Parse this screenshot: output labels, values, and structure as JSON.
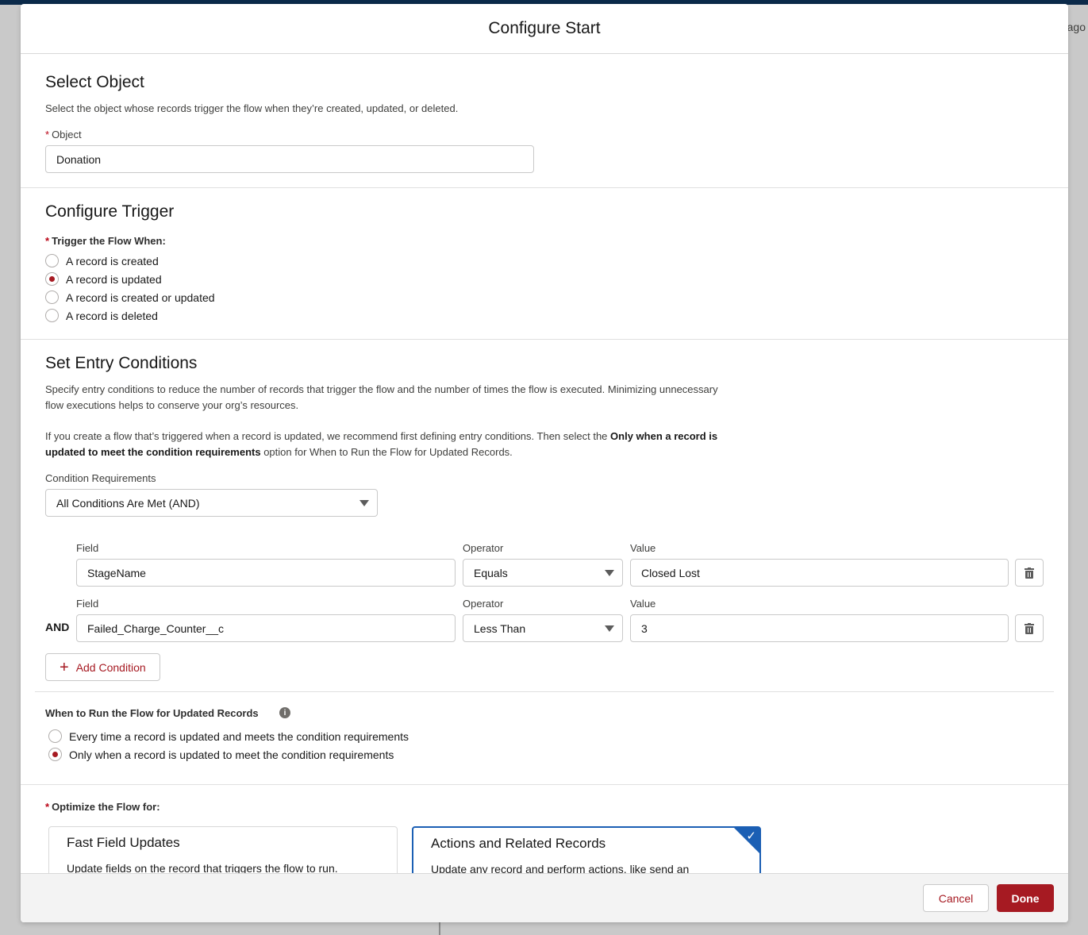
{
  "background": {
    "right_text": "ago"
  },
  "modal": {
    "title": "Configure Start"
  },
  "select_object": {
    "title": "Select Object",
    "help": "Select the object whose records trigger the flow when they’re created, updated, or deleted.",
    "object_label": "Object",
    "required_marker": "*",
    "object_value": "Donation"
  },
  "configure_trigger": {
    "title": "Configure Trigger",
    "label": "Trigger the Flow When:",
    "required_marker": "*",
    "options": [
      {
        "label": "A record is created",
        "selected": false
      },
      {
        "label": "A record is updated",
        "selected": true
      },
      {
        "label": "A record is created or updated",
        "selected": false
      },
      {
        "label": "A record is deleted",
        "selected": false
      }
    ]
  },
  "entry_conditions": {
    "title": "Set Entry Conditions",
    "help1_line1": "Specify entry conditions to reduce the number of records that trigger the flow and the number of times the flow is executed. Minimizing unnecessary",
    "help1_line2": "flow executions helps to conserve your org’s resources.",
    "help2_pre": "If you create a flow that’s triggered when a record is updated, we recommend first defining entry conditions. Then select the ",
    "help2_bold1": "Only when a record is",
    "help2_bold2": "updated to meet the condition requirements",
    "help2_post": " option for When to Run the Flow for Updated Records.",
    "requirements_label": "Condition Requirements",
    "requirements_value": "All Conditions Are Met (AND)",
    "conditions": [
      {
        "connector": "",
        "field_label": "Field",
        "field": "StageName",
        "operator_label": "Operator",
        "operator": "Equals",
        "value_label": "Value",
        "value": "Closed Lost"
      },
      {
        "connector": "AND",
        "field_label": "Field",
        "field": "Failed_Charge_Counter__c",
        "operator_label": "Operator",
        "operator": "Less Than",
        "value_label": "Value",
        "value": "3"
      }
    ],
    "add_condition": "Add Condition",
    "add_icon": "plus-icon",
    "delete_icon": "trash-icon"
  },
  "when_to_run": {
    "label": "When to Run the Flow for Updated Records",
    "info_icon": "info-icon",
    "info_glyph": "i",
    "options": [
      {
        "label": "Every time a record is updated and meets the condition requirements",
        "selected": false
      },
      {
        "label": "Only when a record is updated to meet the condition requirements",
        "selected": true
      }
    ]
  },
  "optimize": {
    "label": "Optimize the Flow for:",
    "required_marker": "*",
    "cards": [
      {
        "title": "Fast Field Updates",
        "desc": "Update fields on the record that triggers the flow to run.",
        "selected": false
      },
      {
        "title": "Actions and Related Records",
        "desc": "Update any record and perform actions, like send an",
        "selected": true
      }
    ],
    "check_glyph": "✓"
  },
  "footer": {
    "cancel": "Cancel",
    "done": "Done"
  },
  "colors": {
    "brand_red": "#a61a22",
    "selection_blue": "#1b5fb4",
    "required_red": "#ba0517"
  }
}
